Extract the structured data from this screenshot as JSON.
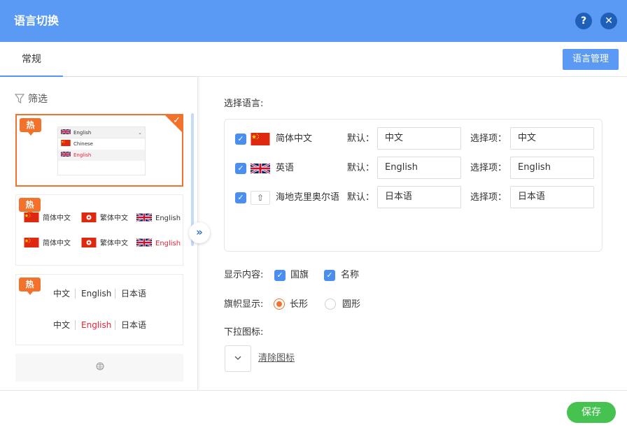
{
  "window": {
    "title": "语言切换",
    "help_label": "?",
    "close_label": "✕"
  },
  "tabs": [
    {
      "label": "常规",
      "active": true
    }
  ],
  "header": {
    "lang_manage_label": "语言管理"
  },
  "sidebar": {
    "filter_label": "筛选",
    "hot_badge": "热",
    "selected_check": "✓",
    "style1": {
      "dropdown_head": "English",
      "items": [
        "Chinese",
        "English"
      ]
    },
    "style2": {
      "row1": [
        "简体中文",
        "繁体中文",
        "English"
      ],
      "row2": [
        "简体中文",
        "繁体中文",
        "English"
      ]
    },
    "style3": {
      "row1": [
        "中文",
        "English",
        "日本语"
      ],
      "row2": [
        "中文",
        "English",
        "日本语"
      ]
    },
    "collapse_label": "»"
  },
  "main": {
    "select_language_label": "选择语言:",
    "default_label": "默认：",
    "option_label": "选择项：",
    "languages": [
      {
        "name": "简体中文",
        "default_value": "中文",
        "option_value": "中文",
        "checked": true,
        "flag": "cn-flag"
      },
      {
        "name": "英语",
        "default_value": "English",
        "option_value": "English",
        "checked": true,
        "flag": "uk-flag"
      },
      {
        "name": "海地克里奥尔语",
        "default_value": "日本语",
        "option_value": "日本语",
        "checked": true,
        "flag": "upload-icon"
      }
    ],
    "display_content_label": "显示内容:",
    "display_flag_label": "国旗",
    "display_name_label": "名称",
    "flag_display_label": "旗帜显示:",
    "flag_rect_label": "长形",
    "flag_round_label": "圆形",
    "flag_shape_selected": "长形",
    "dropdown_icon_label": "下拉图标:",
    "clear_icon_label": "清除图标"
  },
  "footer": {
    "save_label": "保存"
  },
  "colors": {
    "primary": "#5a9af5",
    "accent": "#f2712b",
    "save": "#45c24f",
    "checkbox": "#4a8ff0"
  }
}
